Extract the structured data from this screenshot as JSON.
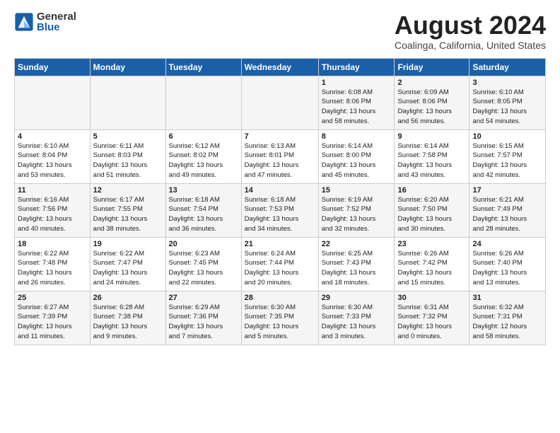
{
  "header": {
    "logo_general": "General",
    "logo_blue": "Blue",
    "month_title": "August 2024",
    "location": "Coalinga, California, United States"
  },
  "days_of_week": [
    "Sunday",
    "Monday",
    "Tuesday",
    "Wednesday",
    "Thursday",
    "Friday",
    "Saturday"
  ],
  "weeks": [
    [
      {
        "day": "",
        "info": ""
      },
      {
        "day": "",
        "info": ""
      },
      {
        "day": "",
        "info": ""
      },
      {
        "day": "",
        "info": ""
      },
      {
        "day": "1",
        "info": "Sunrise: 6:08 AM\nSunset: 8:06 PM\nDaylight: 13 hours\nand 58 minutes."
      },
      {
        "day": "2",
        "info": "Sunrise: 6:09 AM\nSunset: 8:06 PM\nDaylight: 13 hours\nand 56 minutes."
      },
      {
        "day": "3",
        "info": "Sunrise: 6:10 AM\nSunset: 8:05 PM\nDaylight: 13 hours\nand 54 minutes."
      }
    ],
    [
      {
        "day": "4",
        "info": "Sunrise: 6:10 AM\nSunset: 8:04 PM\nDaylight: 13 hours\nand 53 minutes."
      },
      {
        "day": "5",
        "info": "Sunrise: 6:11 AM\nSunset: 8:03 PM\nDaylight: 13 hours\nand 51 minutes."
      },
      {
        "day": "6",
        "info": "Sunrise: 6:12 AM\nSunset: 8:02 PM\nDaylight: 13 hours\nand 49 minutes."
      },
      {
        "day": "7",
        "info": "Sunrise: 6:13 AM\nSunset: 8:01 PM\nDaylight: 13 hours\nand 47 minutes."
      },
      {
        "day": "8",
        "info": "Sunrise: 6:14 AM\nSunset: 8:00 PM\nDaylight: 13 hours\nand 45 minutes."
      },
      {
        "day": "9",
        "info": "Sunrise: 6:14 AM\nSunset: 7:58 PM\nDaylight: 13 hours\nand 43 minutes."
      },
      {
        "day": "10",
        "info": "Sunrise: 6:15 AM\nSunset: 7:57 PM\nDaylight: 13 hours\nand 42 minutes."
      }
    ],
    [
      {
        "day": "11",
        "info": "Sunrise: 6:16 AM\nSunset: 7:56 PM\nDaylight: 13 hours\nand 40 minutes."
      },
      {
        "day": "12",
        "info": "Sunrise: 6:17 AM\nSunset: 7:55 PM\nDaylight: 13 hours\nand 38 minutes."
      },
      {
        "day": "13",
        "info": "Sunrise: 6:18 AM\nSunset: 7:54 PM\nDaylight: 13 hours\nand 36 minutes."
      },
      {
        "day": "14",
        "info": "Sunrise: 6:18 AM\nSunset: 7:53 PM\nDaylight: 13 hours\nand 34 minutes."
      },
      {
        "day": "15",
        "info": "Sunrise: 6:19 AM\nSunset: 7:52 PM\nDaylight: 13 hours\nand 32 minutes."
      },
      {
        "day": "16",
        "info": "Sunrise: 6:20 AM\nSunset: 7:50 PM\nDaylight: 13 hours\nand 30 minutes."
      },
      {
        "day": "17",
        "info": "Sunrise: 6:21 AM\nSunset: 7:49 PM\nDaylight: 13 hours\nand 28 minutes."
      }
    ],
    [
      {
        "day": "18",
        "info": "Sunrise: 6:22 AM\nSunset: 7:48 PM\nDaylight: 13 hours\nand 26 minutes."
      },
      {
        "day": "19",
        "info": "Sunrise: 6:22 AM\nSunset: 7:47 PM\nDaylight: 13 hours\nand 24 minutes."
      },
      {
        "day": "20",
        "info": "Sunrise: 6:23 AM\nSunset: 7:45 PM\nDaylight: 13 hours\nand 22 minutes."
      },
      {
        "day": "21",
        "info": "Sunrise: 6:24 AM\nSunset: 7:44 PM\nDaylight: 13 hours\nand 20 minutes."
      },
      {
        "day": "22",
        "info": "Sunrise: 6:25 AM\nSunset: 7:43 PM\nDaylight: 13 hours\nand 18 minutes."
      },
      {
        "day": "23",
        "info": "Sunrise: 6:26 AM\nSunset: 7:42 PM\nDaylight: 13 hours\nand 15 minutes."
      },
      {
        "day": "24",
        "info": "Sunrise: 6:26 AM\nSunset: 7:40 PM\nDaylight: 13 hours\nand 13 minutes."
      }
    ],
    [
      {
        "day": "25",
        "info": "Sunrise: 6:27 AM\nSunset: 7:39 PM\nDaylight: 13 hours\nand 11 minutes."
      },
      {
        "day": "26",
        "info": "Sunrise: 6:28 AM\nSunset: 7:38 PM\nDaylight: 13 hours\nand 9 minutes."
      },
      {
        "day": "27",
        "info": "Sunrise: 6:29 AM\nSunset: 7:36 PM\nDaylight: 13 hours\nand 7 minutes."
      },
      {
        "day": "28",
        "info": "Sunrise: 6:30 AM\nSunset: 7:35 PM\nDaylight: 13 hours\nand 5 minutes."
      },
      {
        "day": "29",
        "info": "Sunrise: 6:30 AM\nSunset: 7:33 PM\nDaylight: 13 hours\nand 3 minutes."
      },
      {
        "day": "30",
        "info": "Sunrise: 6:31 AM\nSunset: 7:32 PM\nDaylight: 13 hours\nand 0 minutes."
      },
      {
        "day": "31",
        "info": "Sunrise: 6:32 AM\nSunset: 7:31 PM\nDaylight: 12 hours\nand 58 minutes."
      }
    ]
  ]
}
